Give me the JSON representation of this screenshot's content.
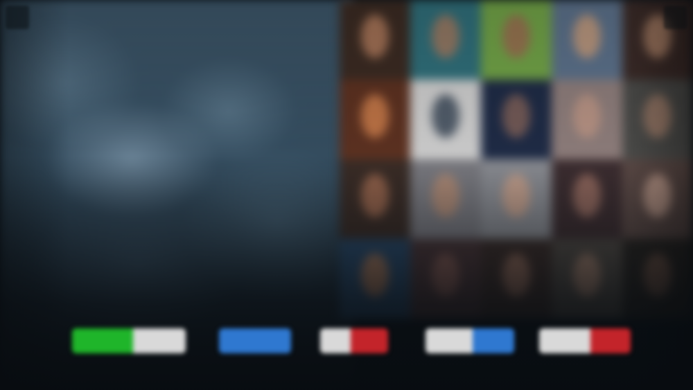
{
  "screen": {
    "description_state": "blurred-background-overlay"
  },
  "colors": {
    "green": "#1fb52a",
    "light": "#d9d9d9",
    "blue": "#2f78d0",
    "red": "#c3242a",
    "dark_bg": "#0d151c"
  },
  "icons": {
    "top_left": "menu-icon",
    "top_right": "close-icon"
  },
  "action_buttons": [
    {
      "id": "action-1",
      "segments": [
        {
          "color": "green"
        },
        {
          "color": "light"
        }
      ]
    },
    {
      "id": "action-2",
      "segments": [
        {
          "color": "blue"
        }
      ]
    },
    {
      "id": "action-3",
      "segments": [
        {
          "color": "light"
        },
        {
          "color": "red"
        }
      ]
    },
    {
      "id": "action-4",
      "segments": [
        {
          "color": "light"
        },
        {
          "color": "blue"
        }
      ]
    },
    {
      "id": "action-5",
      "segments": [
        {
          "color": "light"
        },
        {
          "color": "red"
        }
      ]
    }
  ]
}
